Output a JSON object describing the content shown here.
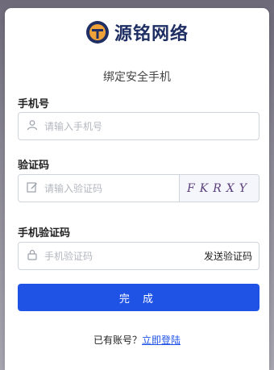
{
  "brand": {
    "name": "源铭网络"
  },
  "form": {
    "subtitle": "绑定安全手机",
    "phone": {
      "label": "手机号",
      "placeholder": "请输入手机号"
    },
    "captcha": {
      "label": "验证码",
      "placeholder": "请输入验证码",
      "image_text": "FKRXY"
    },
    "sms": {
      "label": "手机验证码",
      "placeholder": "手机验证码",
      "send_label": "发送验证码"
    },
    "submit_label": "完 成"
  },
  "footer": {
    "prompt": "已有账号？",
    "login_link": "立即登陆"
  },
  "colors": {
    "primary": "#1f53e6",
    "brand_text": "#1f2f63",
    "logo_orange": "#f0a23a"
  }
}
